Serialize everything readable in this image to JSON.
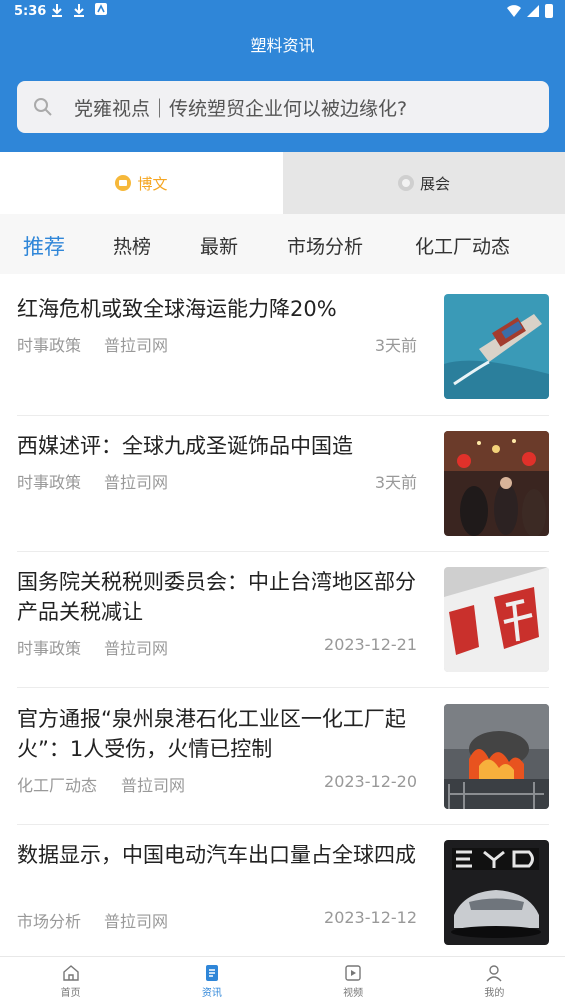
{
  "status": {
    "time": "5:36"
  },
  "header": {
    "title": "塑料资讯"
  },
  "search": {
    "text": "党雍视点｜传统塑贸企业何以被边缘化?"
  },
  "type_tabs": [
    {
      "label": "博文",
      "icon": "blog-icon",
      "active": true
    },
    {
      "label": "展会",
      "icon": "expo-icon",
      "active": false
    }
  ],
  "categories": [
    "推荐",
    "热榜",
    "最新",
    "市场分析",
    "化工厂动态"
  ],
  "news": [
    {
      "title": "红海危机或致全球海运能力降20%",
      "category": "时事政策",
      "source": "普拉司网",
      "time": "3天前",
      "thumb": "cargo-ship-image"
    },
    {
      "title": "西媒述评：全球九成圣诞饰品中国造",
      "category": "时事政策",
      "source": "普拉司网",
      "time": "3天前",
      "thumb": "christmas-market-image"
    },
    {
      "title": "国务院关税税则委员会：中止台湾地区部分产品关税减让",
      "category": "时事政策",
      "source": "普拉司网",
      "time": "2023-12-21",
      "thumb": "tax-sign-image"
    },
    {
      "title": "官方通报“泉州泉港石化工业区一化工厂起火”：1人受伤，火情已控制",
      "category": "化工厂动态",
      "source": "普拉司网",
      "time": "2023-12-20",
      "thumb": "factory-fire-image"
    },
    {
      "title": "数据显示，中国电动汽车出口量占全球四成",
      "category": "市场分析",
      "source": "普拉司网",
      "time": "2023-12-12",
      "thumb": "byd-car-image"
    }
  ],
  "bottom_nav": [
    {
      "label": "首页",
      "icon": "home-icon",
      "active": false
    },
    {
      "label": "资讯",
      "icon": "news-icon",
      "active": true
    },
    {
      "label": "视频",
      "icon": "video-icon",
      "active": false
    },
    {
      "label": "我的",
      "icon": "profile-icon",
      "active": false
    }
  ],
  "colors": {
    "brand": "#2f86d8",
    "accent": "#f5a623"
  }
}
